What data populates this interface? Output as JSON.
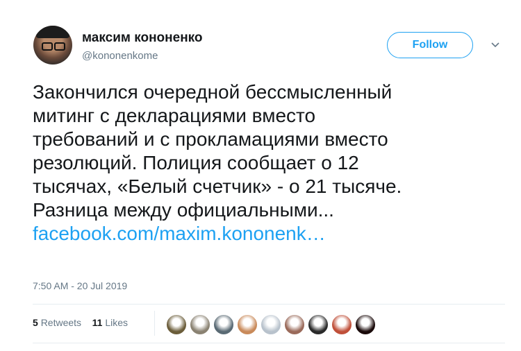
{
  "user": {
    "display_name": "максим кононенко",
    "handle": "@kononenkome"
  },
  "follow_button": {
    "label": "Follow"
  },
  "tweet": {
    "lines": [
      "Закончился очередной бессмысленный",
      "митинг с декларациями вместо",
      "требований и с прокламациями вместо",
      "резолюций. Полиция сообщает о 12",
      "тысячах, «Белый счетчик» - о 21 тысяче.",
      "Разница между официальными..."
    ],
    "link": "facebook.com/maxim.kononenk…"
  },
  "timestamp": "7:50 AM - 20 Jul 2019",
  "stats": {
    "retweets_count": "5",
    "retweets_label": "Retweets",
    "likes_count": "11",
    "likes_label": "Likes"
  },
  "likers_avatars": [
    {
      "name": "liker-1",
      "color": "#6b5d3a"
    },
    {
      "name": "liker-2",
      "color": "#8a8272"
    },
    {
      "name": "liker-3",
      "color": "#5a6a74"
    },
    {
      "name": "liker-4",
      "color": "#c98a5a"
    },
    {
      "name": "liker-5",
      "color": "#b8c2cc"
    },
    {
      "name": "liker-6",
      "color": "#9a6a5a"
    },
    {
      "name": "liker-7",
      "color": "#2a2a2a"
    },
    {
      "name": "liker-8",
      "color": "#c0503a"
    },
    {
      "name": "liker-9",
      "color": "#1a0a0a"
    }
  ],
  "colors": {
    "accent": "#1da1f2",
    "muted": "#657786",
    "text": "#14171a"
  }
}
